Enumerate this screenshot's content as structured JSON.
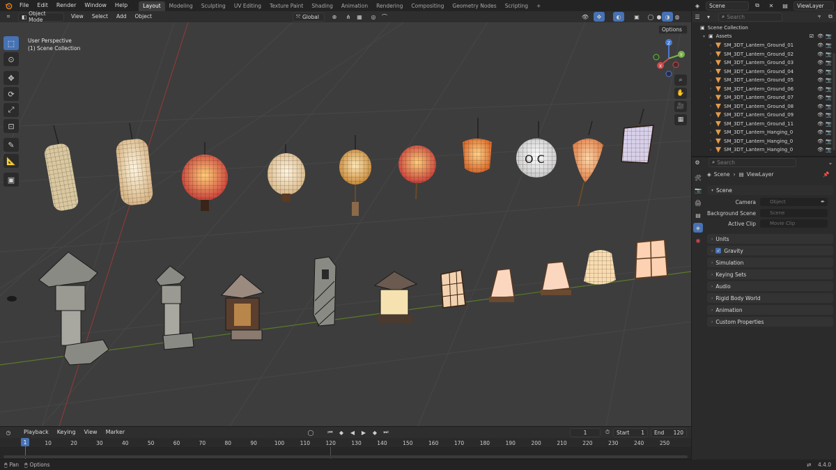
{
  "topbar": {
    "menu": [
      "File",
      "Edit",
      "Render",
      "Window",
      "Help"
    ],
    "workspaces": [
      "Layout",
      "Modeling",
      "Sculpting",
      "UV Editing",
      "Texture Paint",
      "Shading",
      "Animation",
      "Rendering",
      "Compositing",
      "Geometry Nodes",
      "Scripting"
    ],
    "active_workspace": "Layout",
    "add_tab": "+",
    "scene_name": "Scene",
    "view_layer": "ViewLayer"
  },
  "viewport_header": {
    "mode": "Object Mode",
    "menus": [
      "View",
      "Select",
      "Add",
      "Object"
    ],
    "transform_orientation": "Global",
    "options_label": "Options"
  },
  "viewport": {
    "perspective_label": "User Perspective",
    "collection_label": "(1) Scene Collection",
    "background_color": "#3d3d3d",
    "grid_color": "#474747",
    "x_axis_color": "#8a3a3a",
    "y_axis_color": "#5a7a2a"
  },
  "outliner": {
    "search_placeholder": "Search",
    "root": "Scene Collection",
    "collection": "Assets",
    "items": [
      "SM_3DT_Lantern_Ground_01",
      "SM_3DT_Lantern_Ground_02",
      "SM_3DT_Lantern_Ground_03",
      "SM_3DT_Lantern_Ground_04",
      "SM_3DT_Lantern_Ground_05",
      "SM_3DT_Lantern_Ground_06",
      "SM_3DT_Lantern_Ground_07",
      "SM_3DT_Lantern_Ground_08",
      "SM_3DT_Lantern_Ground_09",
      "SM_3DT_Lantern_Ground_11",
      "SM_3DT_Lantern_Hanging_0",
      "SM_3DT_Lantern_Hanging_0",
      "SM_3DT_Lantern_Hanging_0"
    ]
  },
  "properties": {
    "search_placeholder": "Search",
    "breadcrumb_scene": "Scene",
    "breadcrumb_layer": "ViewLayer",
    "section_title": "Scene",
    "fields": [
      {
        "label": "Camera",
        "placeholder": "Object"
      },
      {
        "label": "Background Scene",
        "placeholder": "Scene"
      },
      {
        "label": "Active Clip",
        "placeholder": "Movie Clip"
      }
    ],
    "panels": [
      "Units",
      "Gravity",
      "Simulation",
      "Keying Sets",
      "Audio",
      "Rigid Body World",
      "Animation",
      "Custom Properties"
    ],
    "gravity_checked": true
  },
  "timeline": {
    "menus": [
      "Playback",
      "Keying",
      "View",
      "Marker"
    ],
    "current_frame": "1",
    "start_label": "Start",
    "start_value": "1",
    "end_label": "End",
    "end_value": "120",
    "frames": [
      "1",
      "10",
      "20",
      "30",
      "40",
      "50",
      "60",
      "70",
      "80",
      "90",
      "100",
      "110",
      "120",
      "130",
      "140",
      "150",
      "160",
      "170",
      "180",
      "190",
      "200",
      "210",
      "220",
      "230",
      "240",
      "250"
    ],
    "frame_values": [
      1,
      10,
      20,
      30,
      40,
      50,
      60,
      70,
      80,
      90,
      100,
      110,
      120,
      130,
      140,
      150,
      160,
      170,
      180,
      190,
      200,
      210,
      220,
      230,
      240,
      250
    ]
  },
  "statusbar": {
    "pan_label": "Pan",
    "options_label": "Options",
    "version": "4.4.0"
  },
  "colors": {
    "accent_blue": "#4772b3",
    "mesh_orange": "#e59a4a"
  }
}
